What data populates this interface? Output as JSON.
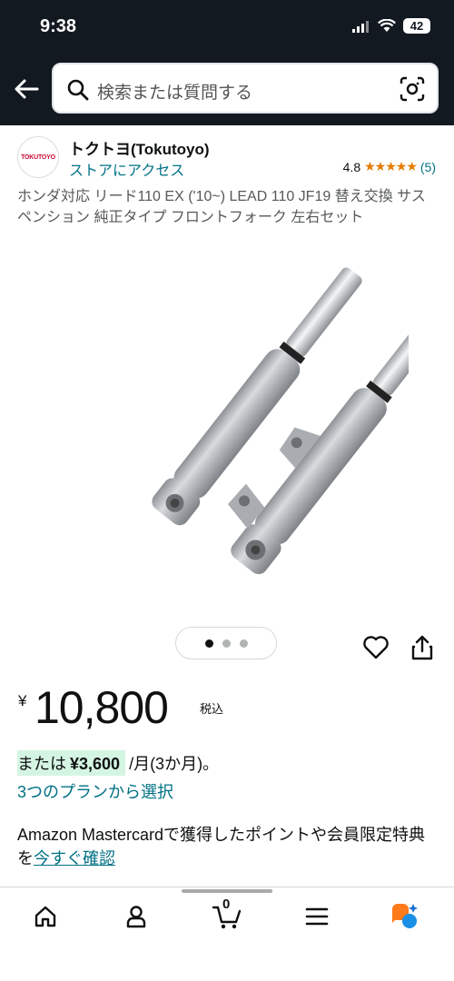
{
  "status": {
    "time": "9:38",
    "battery": "42"
  },
  "search": {
    "placeholder": "検索または質問する"
  },
  "seller": {
    "logo_text": "TOKUTOYO",
    "name": "トクトヨ(Tokutoyo)",
    "store_link": "ストアにアクセス",
    "rating": "4.8",
    "stars": "★★★★★",
    "review_count": "(5)"
  },
  "product": {
    "title": "ホンダ対応 リード110 EX ('10~) LEAD 110 JF19 替え交換 サスペンション 純正タイプ フロントフォーク 左右セット",
    "image_count": 3,
    "active_image": 1
  },
  "price": {
    "currency_symbol": "¥",
    "amount": "10,800",
    "tax_label": "税込"
  },
  "installment": {
    "prefix": "または",
    "amount": "¥3,600",
    "suffix": "/月(3か月)。",
    "plans_link": "3つのプランから選択"
  },
  "promo": {
    "text": "Amazon Mastercardで獲得したポイントや会員限定特典を",
    "link": "今すぐ確認"
  },
  "cart": {
    "count": "0"
  },
  "colors": {
    "header_bg": "#131921",
    "link": "#007185",
    "star": "#e67a00",
    "installment_highlight": "#d5f5e3"
  }
}
